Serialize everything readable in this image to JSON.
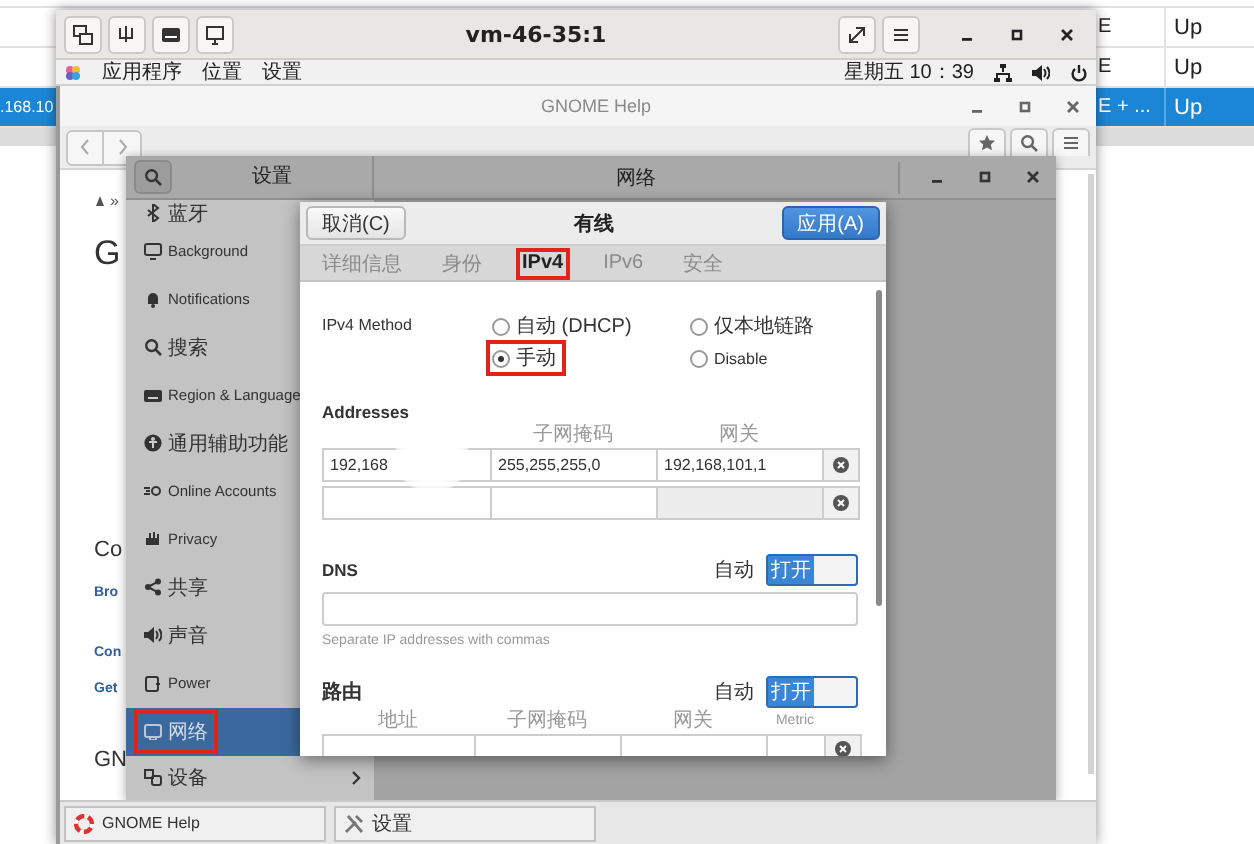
{
  "background_table": {
    "rows": [
      {
        "column_2": "E",
        "column_3": "Up",
        "selected": false
      },
      {
        "column_2": "E",
        "column_3": "Up",
        "selected": false
      },
      {
        "column_1": ".168.10",
        "column_2": "E + ...",
        "column_3": "Up",
        "selected": true
      }
    ]
  },
  "vm_window": {
    "title": "vm-46-35:1"
  },
  "top_bar": {
    "menus": [
      "应用程序",
      "位置",
      "设置"
    ],
    "clock": "星期五 10：39"
  },
  "help_window": {
    "title": "GNOME Help",
    "breadcrumb": "»",
    "fragments": [
      {
        "kind": "heading",
        "text": "G"
      },
      {
        "kind": "heading",
        "text": "Co"
      },
      {
        "kind": "link",
        "text": "Bro"
      },
      {
        "kind": "link",
        "text": "Con"
      },
      {
        "kind": "link",
        "text": "Get"
      },
      {
        "kind": "heading",
        "text": "GN"
      }
    ]
  },
  "settings_window": {
    "sidebar_title": "设置",
    "page_title": "网络",
    "sidebar": [
      {
        "label": "蓝牙",
        "selected": false,
        "highlighted": false
      },
      {
        "label": "Background",
        "selected": false,
        "highlighted": false
      },
      {
        "label": "Notifications",
        "selected": false,
        "highlighted": false
      },
      {
        "label": "搜索",
        "selected": false,
        "highlighted": false
      },
      {
        "label": "Region & Language",
        "selected": false,
        "highlighted": false
      },
      {
        "label": "通用辅助功能",
        "selected": false,
        "highlighted": false
      },
      {
        "label": "Online Accounts",
        "selected": false,
        "highlighted": false
      },
      {
        "label": "Privacy",
        "selected": false,
        "highlighted": false
      },
      {
        "label": "共享",
        "selected": false,
        "highlighted": false
      },
      {
        "label": "声音",
        "selected": false,
        "highlighted": false
      },
      {
        "label": "Power",
        "selected": false,
        "highlighted": false
      },
      {
        "label": "网络",
        "selected": true,
        "highlighted": true
      },
      {
        "label": "设备",
        "selected": false,
        "highlighted": false,
        "has_submenu": true
      }
    ]
  },
  "dialog": {
    "title": "有线",
    "cancel": "取消(C)",
    "apply": "应用(A)",
    "tabs": [
      {
        "label": "详细信息",
        "selected": false,
        "highlighted": false
      },
      {
        "label": "身份",
        "selected": false,
        "highlighted": false
      },
      {
        "label": "IPv4",
        "selected": true,
        "highlighted": true
      },
      {
        "label": "IPv6",
        "selected": false,
        "highlighted": false
      },
      {
        "label": "安全",
        "selected": false,
        "highlighted": false
      }
    ],
    "ipv4_method": {
      "label": "IPv4 Method",
      "options": [
        {
          "label": "自动 (DHCP)",
          "selected": false,
          "highlighted": false
        },
        {
          "label": "仅本地链路",
          "selected": false,
          "highlighted": false
        },
        {
          "label": "手动",
          "selected": true,
          "highlighted": true
        },
        {
          "label": "Disable",
          "selected": false,
          "highlighted": false
        }
      ]
    },
    "addresses": {
      "label": "Addresses",
      "netmask_header": "子网掩码",
      "gateway_header": "网关",
      "rows": [
        {
          "address": "192,168",
          "netmask": "255,255,255,0",
          "gateway": "192,168,101,1",
          "gateway_disabled": false
        },
        {
          "gateway_disabled": true
        }
      ]
    },
    "dns": {
      "label": "DNS",
      "auto_label": "自动",
      "switch": {
        "label": "打开",
        "on": true
      },
      "hint": "Separate IP addresses with commas"
    },
    "routes": {
      "label": "路由",
      "auto_label": "自动",
      "switch": {
        "label": "打开",
        "on": true
      },
      "columns": [
        "地址",
        "子网掩码",
        "网关",
        "Metric"
      ]
    }
  },
  "taskbar": {
    "items": [
      {
        "label": "GNOME Help"
      },
      {
        "label": "设置"
      }
    ]
  }
}
